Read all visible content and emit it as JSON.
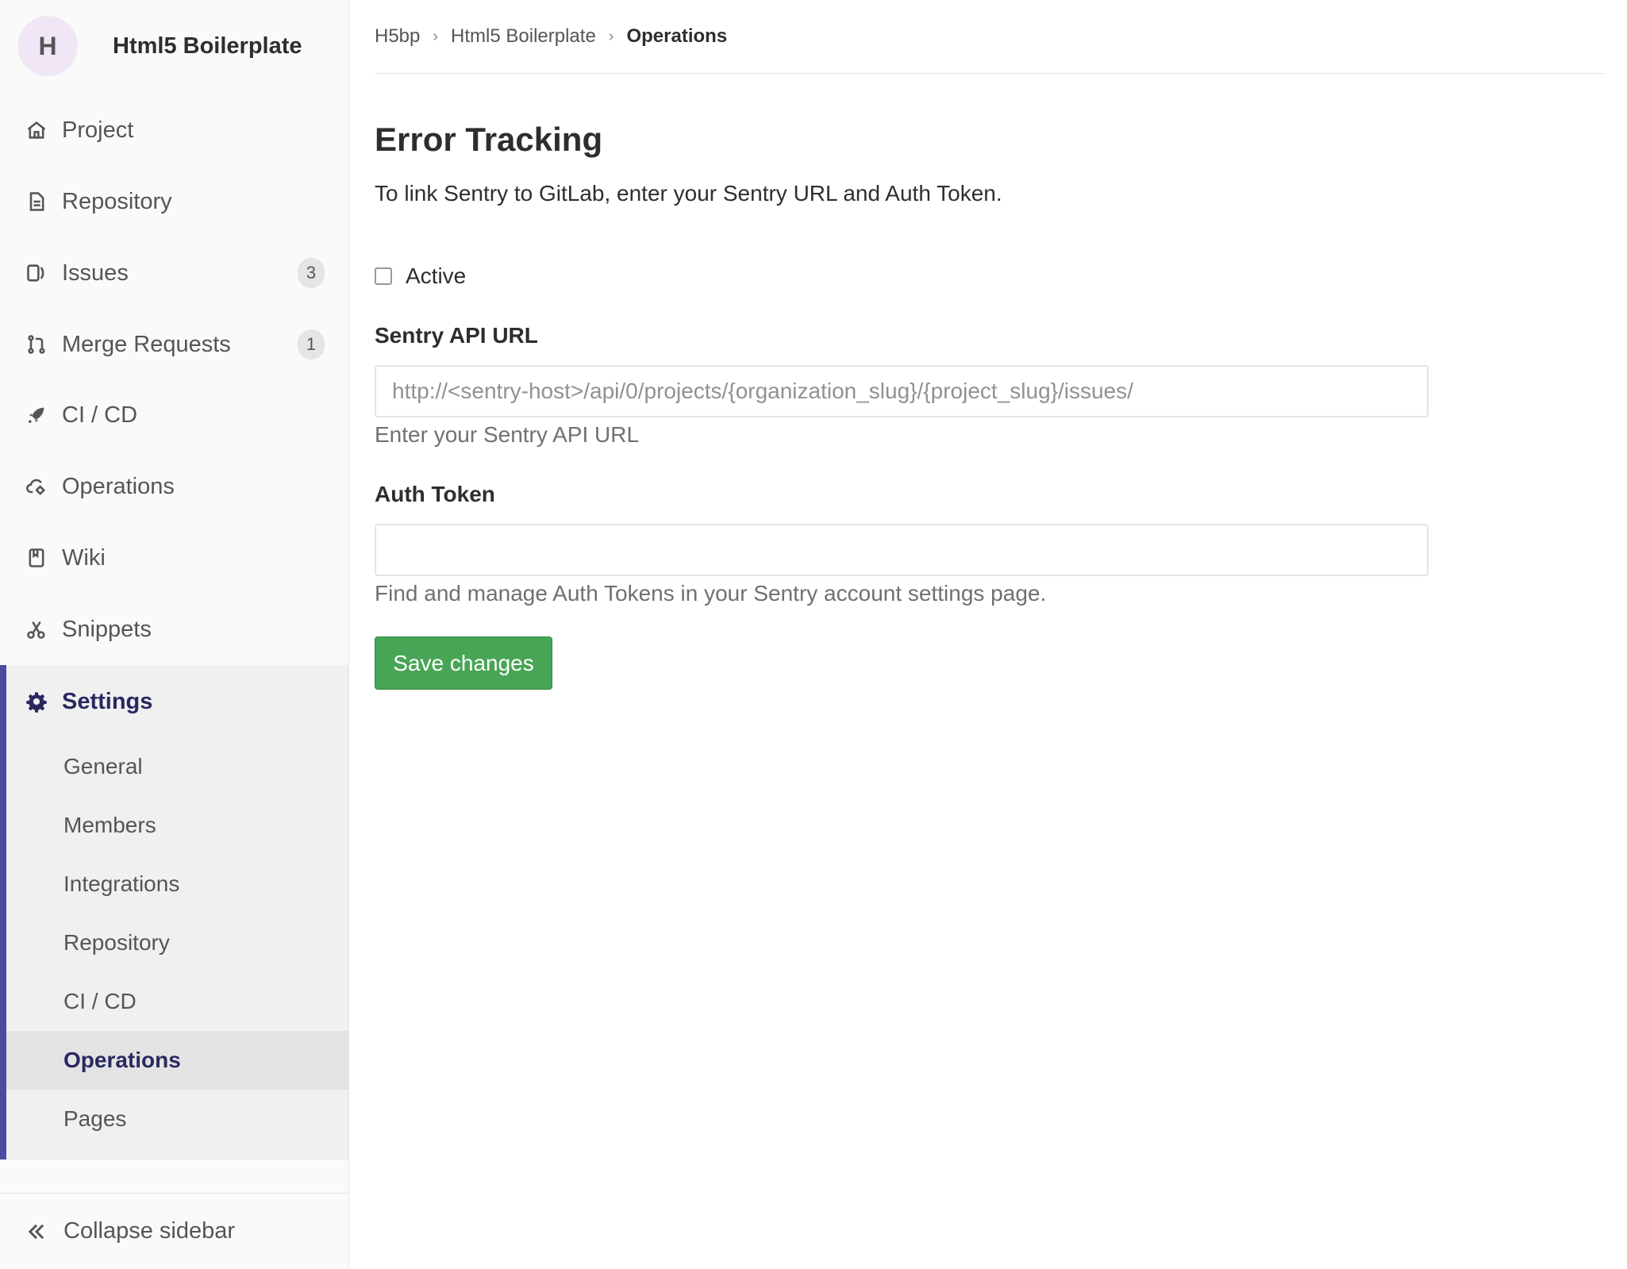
{
  "sidebar": {
    "project_initial": "H",
    "project_name": "Html5 Boilerplate",
    "items": [
      {
        "label": "Project",
        "icon": "home-icon"
      },
      {
        "label": "Repository",
        "icon": "doc-icon"
      },
      {
        "label": "Issues",
        "icon": "issues-icon",
        "badge": "3"
      },
      {
        "label": "Merge Requests",
        "icon": "merge-request-icon",
        "badge": "1"
      },
      {
        "label": "CI / CD",
        "icon": "rocket-icon"
      },
      {
        "label": "Operations",
        "icon": "cloud-gear-icon"
      },
      {
        "label": "Wiki",
        "icon": "book-icon"
      },
      {
        "label": "Snippets",
        "icon": "scissors-icon"
      }
    ],
    "settings": {
      "label": "Settings",
      "icon": "gear-icon",
      "subitems": [
        {
          "label": "General"
        },
        {
          "label": "Members"
        },
        {
          "label": "Integrations"
        },
        {
          "label": "Repository"
        },
        {
          "label": "CI / CD"
        },
        {
          "label": "Operations",
          "active": true
        },
        {
          "label": "Pages"
        }
      ]
    },
    "collapse_label": "Collapse sidebar"
  },
  "breadcrumb": [
    "H5bp",
    "Html5 Boilerplate",
    "Operations"
  ],
  "main": {
    "title": "Error Tracking",
    "intro": "To link Sentry to GitLab, enter your Sentry URL and Auth Token.",
    "active_label": "Active",
    "active_checked": false,
    "sentry_label": "Sentry API URL",
    "sentry_placeholder": "http://<sentry-host>/api/0/projects/{organization_slug}/{project_slug}/issues/",
    "sentry_value": "",
    "sentry_help": "Enter your Sentry API URL",
    "token_label": "Auth Token",
    "token_value": "",
    "token_help": "Find and manage Auth Tokens in your Sentry account settings page.",
    "save_label": "Save changes"
  },
  "colors": {
    "accent": "#292961",
    "active_bar": "#4b4ba3",
    "save_button": "#48a555"
  }
}
